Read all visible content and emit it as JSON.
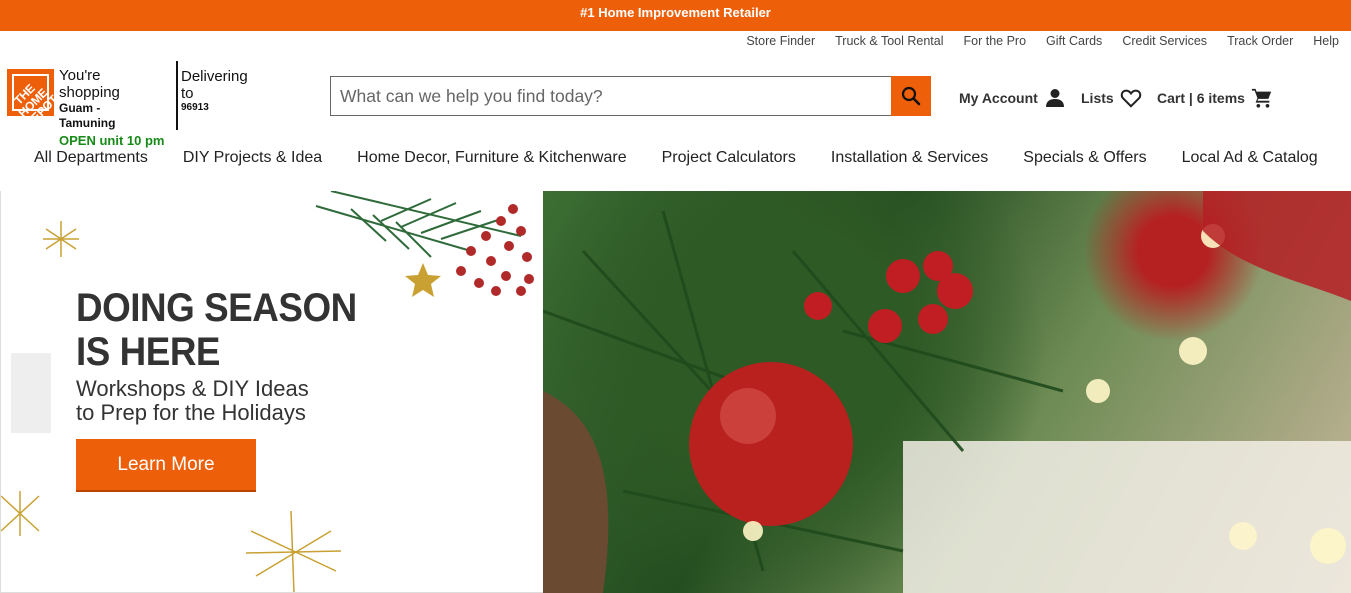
{
  "promo": {
    "text": "#1 Home Improvement Retailer"
  },
  "utility_links": [
    "Store Finder",
    "Truck & Tool Rental",
    "For the Pro",
    "Gift Cards",
    "Credit Services",
    "Track Order",
    "Help"
  ],
  "logo": {
    "text": "THE HOME DEPOT"
  },
  "store": {
    "line1": "You're",
    "line2": "shopping",
    "name1": "Guam -",
    "name2": "Tamuning",
    "hours": "OPEN unit 10 pm"
  },
  "delivery": {
    "line1": "Delivering",
    "line2": "to",
    "zip": "96913"
  },
  "search": {
    "placeholder": "What can we help you find today?"
  },
  "account": {
    "label": "My Account"
  },
  "lists": {
    "label": "Lists"
  },
  "cart": {
    "label": "Cart | 6 items"
  },
  "nav": [
    "All Departments",
    "DIY Projects & Idea",
    "Home Decor, Furniture & Kitchenware",
    "Project Calculators",
    "Installation & Services",
    "Specials & Offers",
    "Local Ad & Catalog"
  ],
  "hero": {
    "headline1": "DOING SEASON",
    "headline2": "IS HERE",
    "sub1": "Workshops & DIY Ideas",
    "sub2": "to Prep for the Holidays",
    "cta": "Learn More"
  },
  "colors": {
    "brand": "#ee5f0a",
    "open_green": "#188a17"
  }
}
